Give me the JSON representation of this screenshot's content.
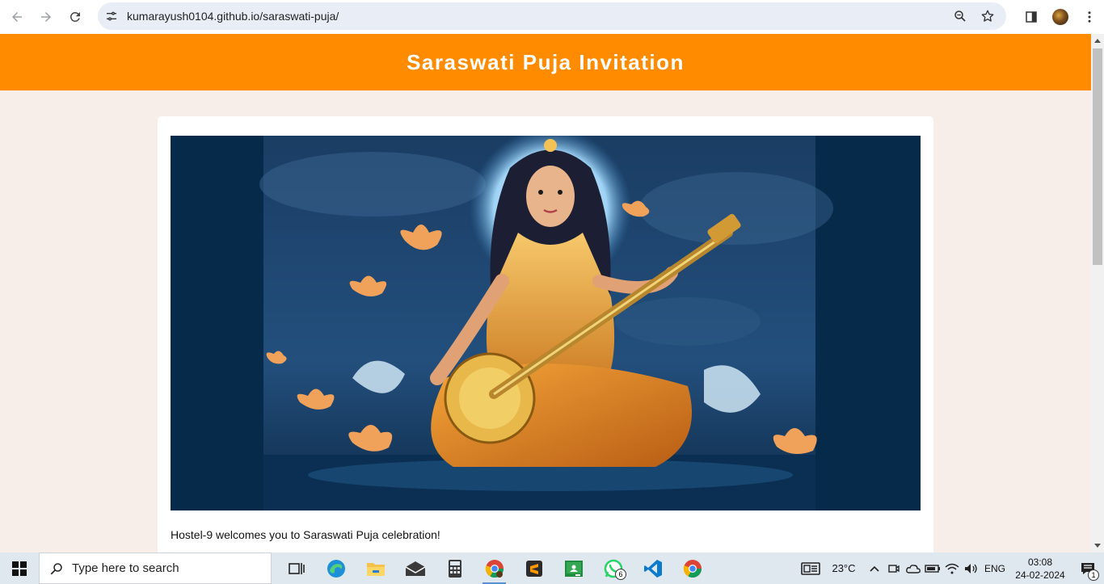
{
  "browser": {
    "url": "kumarayush0104.github.io/saraswati-puja/"
  },
  "site": {
    "title": "Saraswati Puja Invitation",
    "welcome_text": "Hostel-9 welcomes you to Saraswati Puja celebration!",
    "header_color": "#ff8c00"
  },
  "hero_image": {
    "subject": "Goddess Saraswati seated playing veena"
  },
  "taskbar": {
    "search_placeholder": "Type here to search",
    "apps": [
      {
        "name": "task-view-icon"
      },
      {
        "name": "edge-icon"
      },
      {
        "name": "file-explorer-icon"
      },
      {
        "name": "mail-icon"
      },
      {
        "name": "calculator-icon"
      },
      {
        "name": "chrome-profile-icon"
      },
      {
        "name": "sublime-icon"
      },
      {
        "name": "classroom-icon"
      },
      {
        "name": "whatsapp-icon",
        "badge": "6"
      },
      {
        "name": "vscode-icon"
      },
      {
        "name": "chrome-icon"
      }
    ],
    "weather": "23°C",
    "language": "ENG",
    "time": "03:08",
    "date": "24-02-2024",
    "notification_count": "1"
  }
}
